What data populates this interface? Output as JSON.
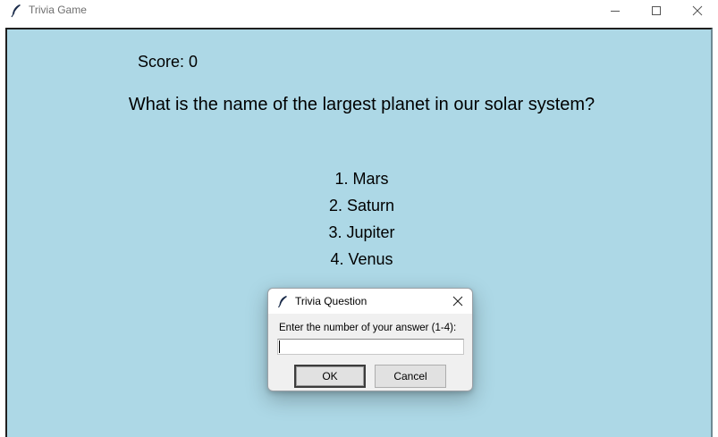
{
  "window": {
    "title": "Trivia Game"
  },
  "game": {
    "score": "Score: 0",
    "question": "What is the name of the largest planet in our solar system?",
    "options": [
      "1. Mars",
      "2. Saturn",
      "3. Jupiter",
      "4. Venus"
    ]
  },
  "dialog": {
    "title": "Trivia Question",
    "prompt": "Enter the number of your answer (1-4):",
    "input_value": "",
    "ok_label": "OK",
    "cancel_label": "Cancel"
  },
  "colors": {
    "background": "#add8e6",
    "dialog_bg": "#f0f0f0"
  },
  "icons": {
    "app": "feather-icon",
    "minimize": "minimize-icon",
    "maximize": "maximize-icon",
    "close": "close-icon"
  }
}
